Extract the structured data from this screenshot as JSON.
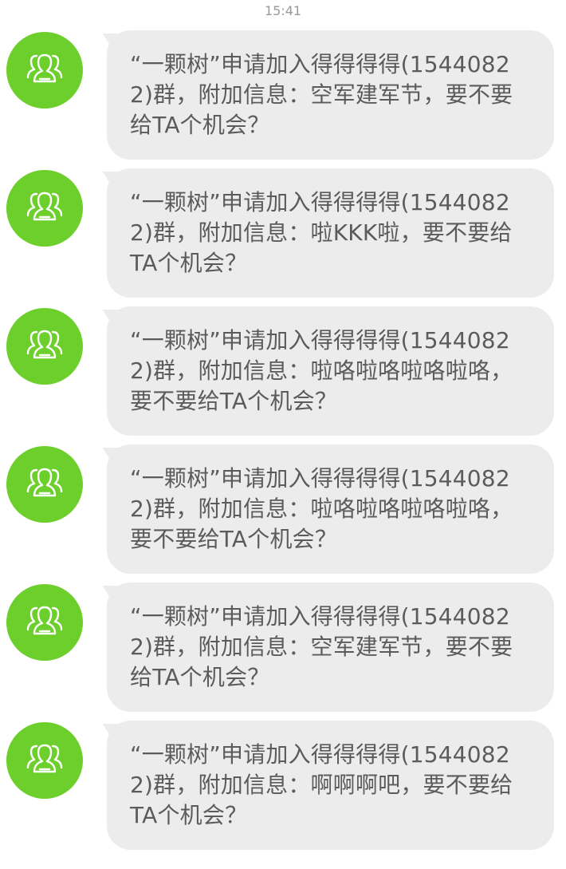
{
  "status": {
    "time": "15:41"
  },
  "colors": {
    "avatar_bg": "#6dcf2c",
    "bubble_bg": "#ececec",
    "text": "#5b5b5b"
  },
  "messages": [
    {
      "avatar_icon": "group-icon",
      "text": "“一颗树”申请加入得得得得(15440822)群，附加信息：空军建军节，要不要给TA个机会？"
    },
    {
      "avatar_icon": "group-icon",
      "text": "“一颗树”申请加入得得得得(15440822)群，附加信息：啦KKK啦，要不要给TA个机会？"
    },
    {
      "avatar_icon": "group-icon",
      "text": "“一颗树”申请加入得得得得(15440822)群，附加信息：啦咯啦咯啦咯啦咯，要不要给TA个机会？"
    },
    {
      "avatar_icon": "group-icon",
      "text": "“一颗树”申请加入得得得得(15440822)群，附加信息：啦咯啦咯啦咯啦咯，要不要给TA个机会？"
    },
    {
      "avatar_icon": "group-icon",
      "text": "“一颗树”申请加入得得得得(15440822)群，附加信息：空军建军节，要不要给TA个机会？"
    },
    {
      "avatar_icon": "group-icon",
      "text": "“一颗树”申请加入得得得得(15440822)群，附加信息：啊啊啊吧，要不要给TA个机会？"
    }
  ]
}
